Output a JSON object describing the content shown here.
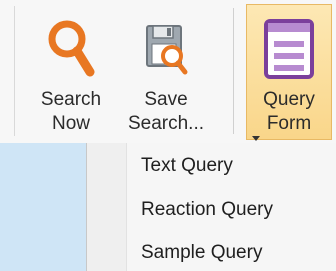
{
  "toolbar": {
    "search_now": {
      "line1": "Search",
      "line2": "Now"
    },
    "save_search": {
      "line1": "Save",
      "line2": "Search..."
    },
    "query_form": {
      "line1": "Query",
      "line2": "Form"
    }
  },
  "dropdown": {
    "items": [
      {
        "label": "Text Query"
      },
      {
        "label": "Reaction Query"
      },
      {
        "label": "Sample Query"
      }
    ]
  },
  "icons": {
    "search_now": "magnifier-icon",
    "save_search": "save-search-icon",
    "query_form": "form-window-icon",
    "query_form_caret": "dropdown-caret-icon"
  },
  "colors": {
    "ribbon_bg": "#f7f7f7",
    "active_button_bg": "#fbe1a0",
    "active_button_border": "#e8b964",
    "search_icon": "#e87722",
    "form_icon": "#7b3f9b",
    "menu_bg": "#f6f6f6",
    "left_panel_bg": "#cfe5f6"
  }
}
